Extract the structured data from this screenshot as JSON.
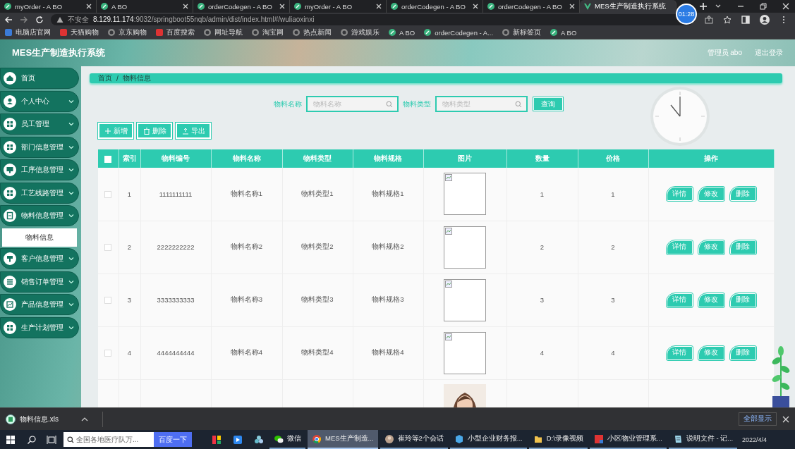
{
  "browser": {
    "tabs": [
      {
        "title": "myOrder - A BO",
        "selected": false
      },
      {
        "title": "A BO",
        "selected": false
      },
      {
        "title": "orderCodegen - A BO",
        "selected": false
      },
      {
        "title": "myOrder - A BO",
        "selected": false
      },
      {
        "title": "orderCodegen - A BO",
        "selected": false
      },
      {
        "title": "orderCodegen - A BO",
        "selected": false
      },
      {
        "title": "MES生产制造执行系统",
        "selected": true
      }
    ],
    "recorder_time": "01:28",
    "security": "不安全",
    "url_host": "8.129.11.174",
    "url_rest": ":9032/springboot55nqb/admin/dist/index.html#/wuliaoxinxi",
    "bookmarks": [
      "电脑店官网",
      "天猫购物",
      "京东购物",
      "百度搜索",
      "网址导航",
      "淘宝网",
      "热点新闻",
      "游戏娱乐",
      "A BO",
      "orderCodegen - A...",
      "新标签页",
      "A BO"
    ]
  },
  "app": {
    "title": "MES生产制造执行系统",
    "user": "管理员 abo",
    "logout": "退出登录"
  },
  "sidebar": {
    "items": [
      {
        "label": "首页"
      },
      {
        "label": "个人中心"
      },
      {
        "label": "员工管理"
      },
      {
        "label": "部门信息管理"
      },
      {
        "label": "工序信息管理"
      },
      {
        "label": "工艺线路管理"
      },
      {
        "label": "物料信息管理",
        "children": [
          {
            "label": "物料信息",
            "selected": true
          }
        ]
      },
      {
        "label": "客户信息管理"
      },
      {
        "label": "销售订单管理"
      },
      {
        "label": "产品信息管理"
      },
      {
        "label": "生产计划管理"
      }
    ]
  },
  "breadcrumb": {
    "items": [
      "首页",
      "物料信息"
    ],
    "separator": "/"
  },
  "search": {
    "fields": [
      {
        "label": "物料名称",
        "placeholder": "物料名称"
      },
      {
        "label": "物料类型",
        "placeholder": "物料类型"
      }
    ],
    "button": "查询"
  },
  "actions": [
    "新增",
    "删除",
    "导出"
  ],
  "table": {
    "select_all_checked": false,
    "columns": [
      "索引",
      "物料编号",
      "物料名称",
      "物料类型",
      "物料规格",
      "图片",
      "数量",
      "价格",
      "操作"
    ],
    "rows": [
      {
        "kind": "record",
        "checked": false,
        "cells": [
          "1",
          "1111111111",
          "物料名称1",
          "物料类型1",
          "物料规格1"
        ],
        "quantity": "1",
        "price": "1",
        "actions": [
          "详情",
          "修改",
          "删除"
        ]
      },
      {
        "kind": "record",
        "checked": false,
        "cells": [
          "2",
          "2222222222",
          "物料名称2",
          "物料类型2",
          "物料规格2"
        ],
        "quantity": "2",
        "price": "2",
        "actions": [
          "详情",
          "修改",
          "删除"
        ]
      },
      {
        "kind": "record",
        "checked": false,
        "cells": [
          "3",
          "3333333333",
          "物料名称3",
          "物料类型3",
          "物料规格3"
        ],
        "quantity": "3",
        "price": "3",
        "actions": [
          "详情",
          "修改",
          "删除"
        ]
      },
      {
        "kind": "record",
        "checked": false,
        "cells": [
          "4",
          "4444444444",
          "物料名称4",
          "物料类型4",
          "物料规格4"
        ],
        "quantity": "4",
        "price": "4",
        "actions": [
          "详情",
          "修改",
          "删除"
        ]
      },
      {
        "kind": "partial"
      }
    ]
  },
  "downloads": {
    "file": "物料信息.xls",
    "show_all": "全部显示"
  },
  "taskbar": {
    "search_value": "全国各地医疗队万...",
    "search_button": "百度一下",
    "apps": [
      {
        "kind": "pinned"
      },
      {
        "kind": "pinned"
      },
      {
        "kind": "pinned"
      },
      {
        "kind": "app",
        "label": "微信",
        "active": false
      },
      {
        "kind": "app",
        "label": "MES生产制造...",
        "active": true
      },
      {
        "kind": "app",
        "label": "崔玲等2个会话",
        "active": false
      },
      {
        "kind": "app",
        "label": "小型企业财务报...",
        "active": false
      },
      {
        "kind": "app",
        "label": "D:\\录像视频",
        "active": false
      },
      {
        "kind": "app",
        "label": "小区物业管理系...",
        "active": false
      },
      {
        "kind": "app",
        "label": "说明文件 - 记...",
        "active": false
      }
    ],
    "date": "2022/4/4"
  }
}
